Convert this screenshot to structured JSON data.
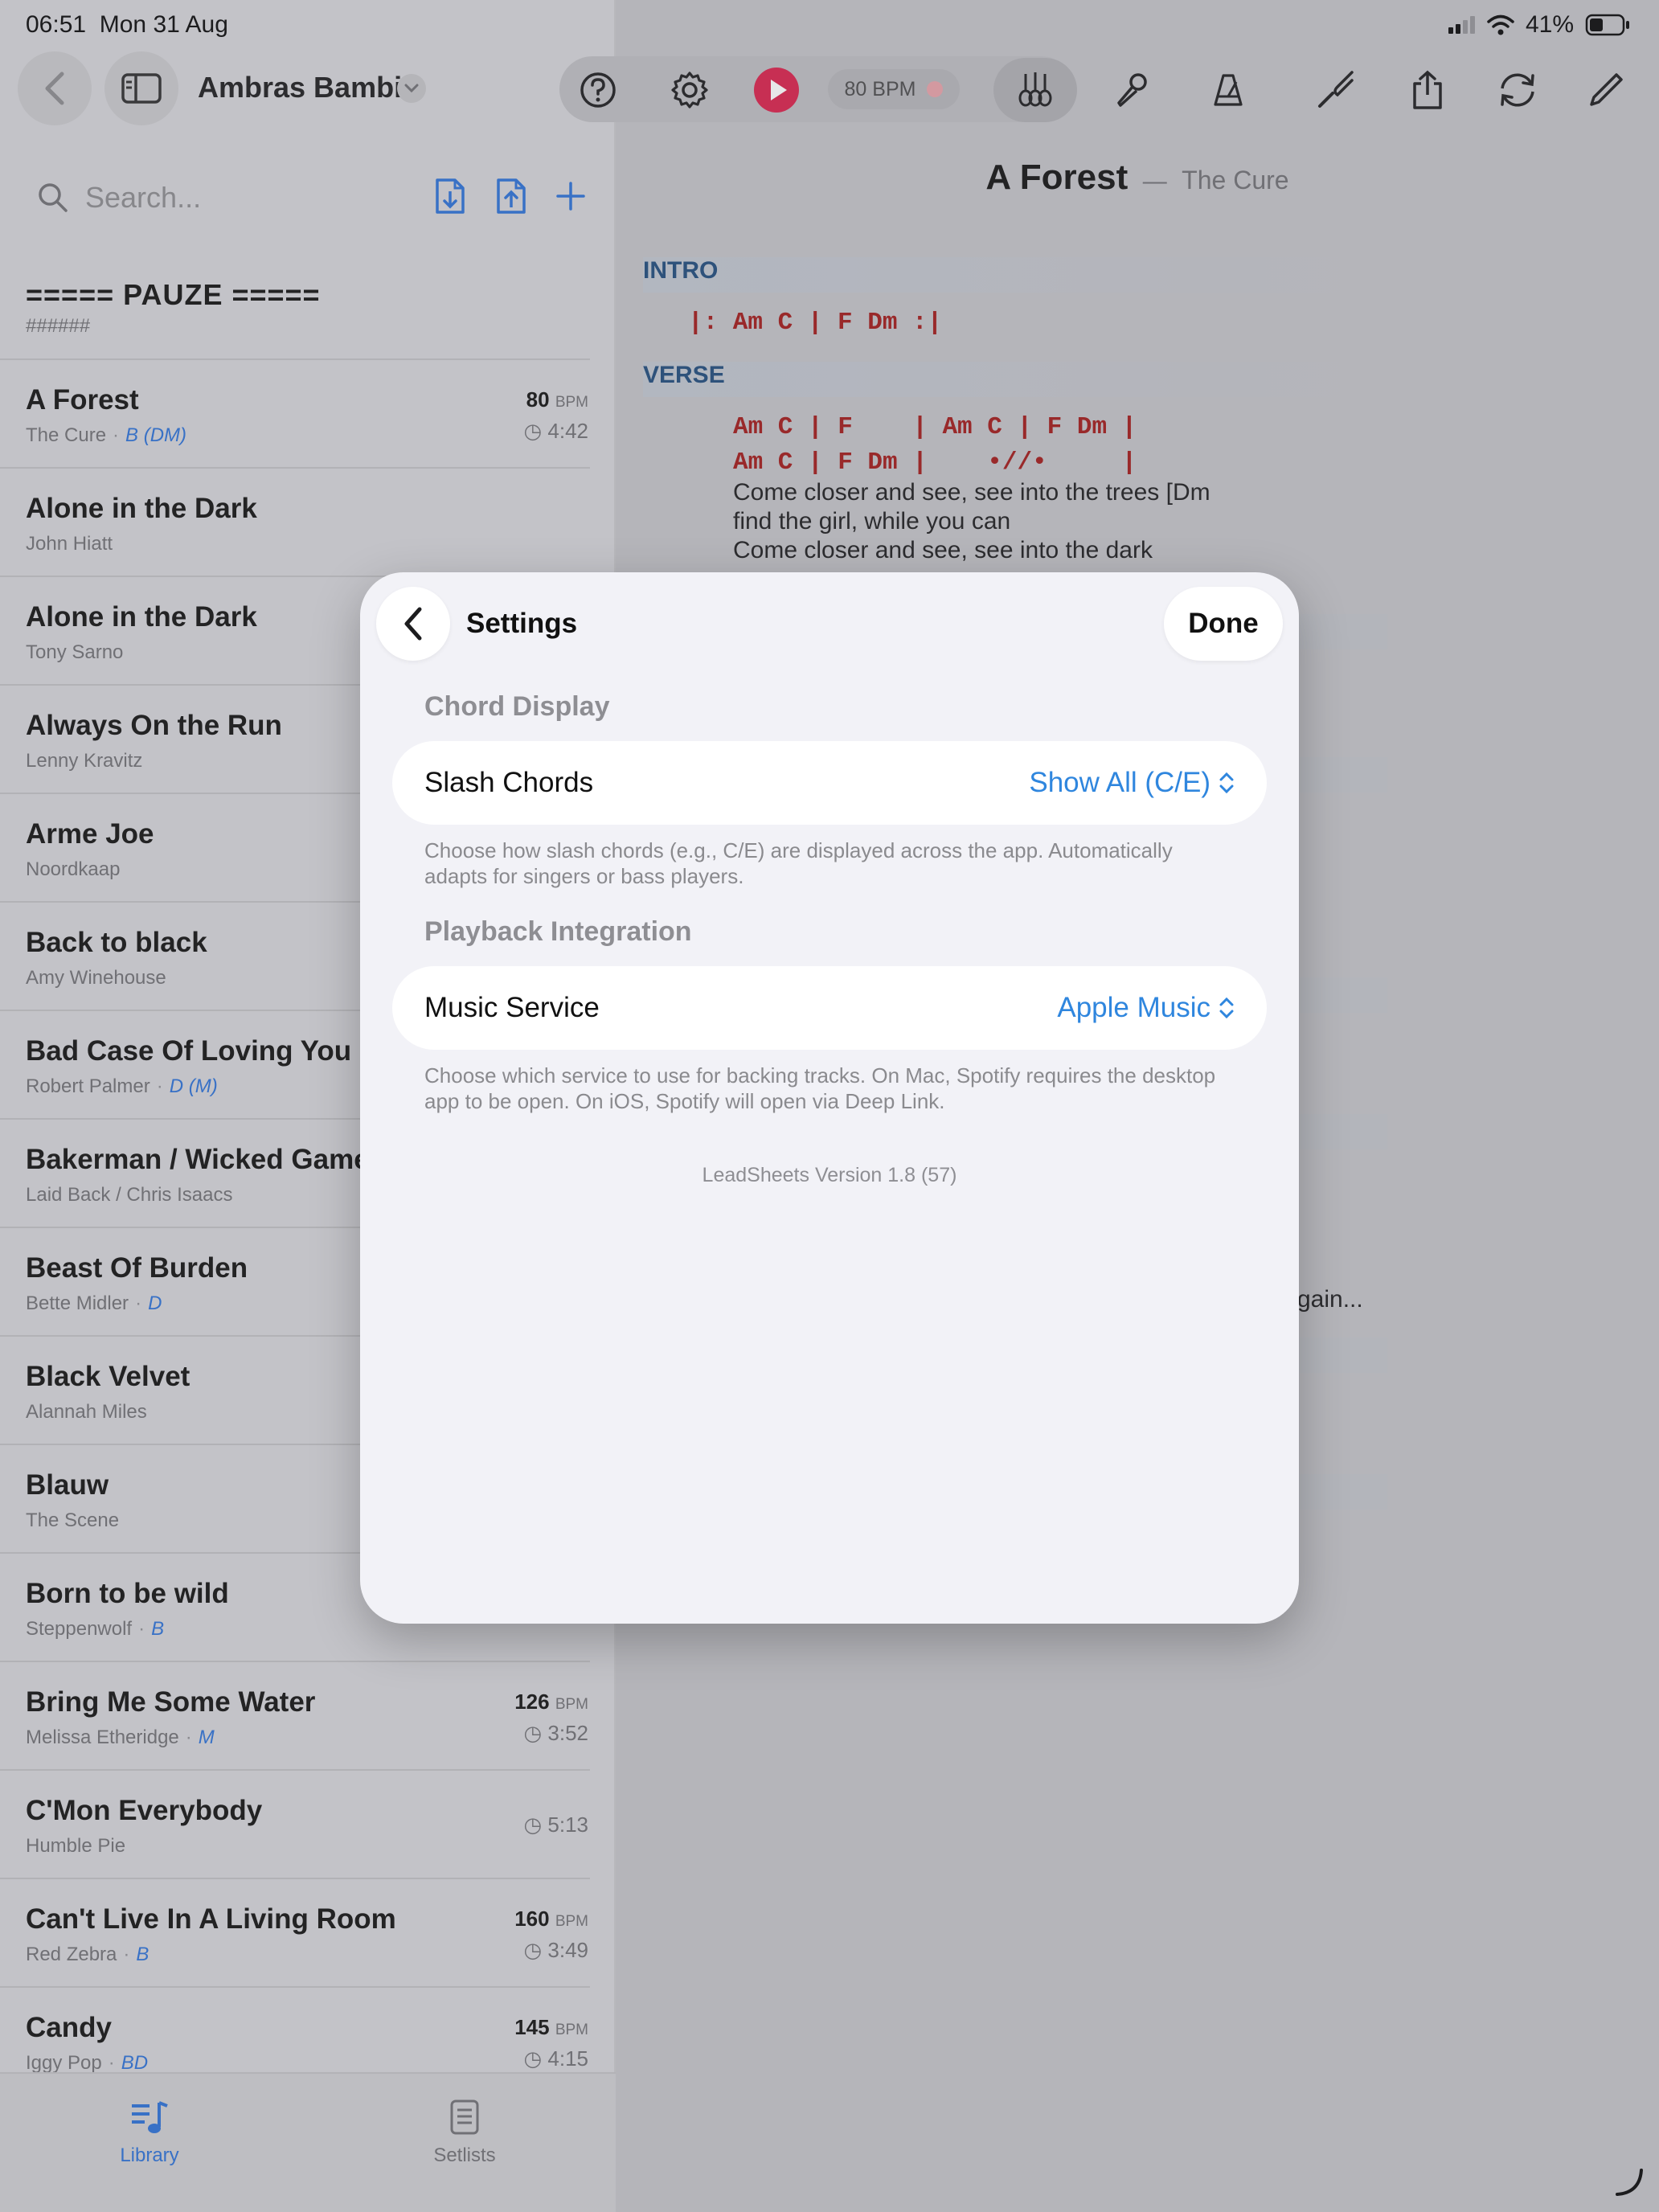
{
  "status": {
    "time": "06:51",
    "date": "Mon 31 Aug",
    "battery": "41%"
  },
  "library": {
    "name": "Ambras Bambi"
  },
  "search": {
    "placeholder": "Search..."
  },
  "songs": [
    {
      "title": "===== PAUZE =====",
      "subtitle": "######",
      "kind": "pause"
    },
    {
      "title": "A Forest",
      "artist": "The Cure",
      "key": "B (DM)",
      "bpm": "80",
      "duration": "4:42"
    },
    {
      "title": "Alone in the Dark",
      "artist": "John Hiatt"
    },
    {
      "title": "Alone in the Dark",
      "artist": "Tony Sarno"
    },
    {
      "title": "Always On the Run",
      "artist": "Lenny Kravitz"
    },
    {
      "title": "Arme Joe",
      "artist": "Noordkaap"
    },
    {
      "title": "Back to black",
      "artist": "Amy Winehouse"
    },
    {
      "title": "Bad Case Of Loving You",
      "artist": "Robert Palmer",
      "key": "D (M)"
    },
    {
      "title": "Bakerman / Wicked Games",
      "artist": "Laid Back / Chris Isaacs"
    },
    {
      "title": "Beast Of Burden",
      "artist": "Bette Midler",
      "key": "D"
    },
    {
      "title": "Black Velvet",
      "artist": "Alannah Miles"
    },
    {
      "title": "Blauw",
      "artist": "The Scene"
    },
    {
      "title": "Born to be wild",
      "artist": "Steppenwolf",
      "key": "B"
    },
    {
      "title": "Bring Me Some Water",
      "artist": "Melissa Etheridge",
      "key": "M",
      "bpm": "126",
      "duration": "3:52"
    },
    {
      "title": "C'Mon Everybody",
      "artist": "Humble Pie",
      "duration": "5:13"
    },
    {
      "title": "Can't Live In A Living Room",
      "artist": "Red Zebra",
      "key": "B",
      "bpm": "160",
      "duration": "3:49"
    },
    {
      "title": "Candy",
      "artist": "Iggy Pop",
      "key": "BD",
      "bpm": "145",
      "duration": "4:15"
    }
  ],
  "bpm_unit": "BPM",
  "tabs": {
    "library": "Library",
    "setlists": "Setlists"
  },
  "toolbar": {
    "bpm": "80 BPM"
  },
  "song": {
    "title": "A Forest",
    "dash": "—",
    "artist": "The Cure",
    "intro_label": "INTRO",
    "intro_chords": "|: Am C | F Dm :|",
    "verse_label": "VERSE",
    "verse_chords_1": "Am C | F    | Am C | F Dm |",
    "verse_chords_2": "Am C | F Dm |    •//•     |",
    "lyric_1": "Come closer and see, see into the trees [Dm",
    "lyric_2": "find the girl, while you can",
    "lyric_3": "Come closer and see, see into the dark",
    "lyric_4": "gain..."
  },
  "settings": {
    "title": "Settings",
    "done": "Done",
    "chord_display": "Chord Display",
    "slash_chords_label": "Slash Chords",
    "slash_chords_value": "Show All (C/E)",
    "slash_help": "Choose how slash chords (e.g., C/E) are displayed across the app. Automatically adapts for singers or bass players.",
    "playback": "Playback Integration",
    "music_service_label": "Music Service",
    "music_service_value": "Apple Music",
    "music_help": "Choose which service to use for backing tracks. On Mac, Spotify requires the desktop app to be open. On iOS, Spotify will open via Deep Link.",
    "version": "LeadSheets Version 1.8 (57)"
  }
}
